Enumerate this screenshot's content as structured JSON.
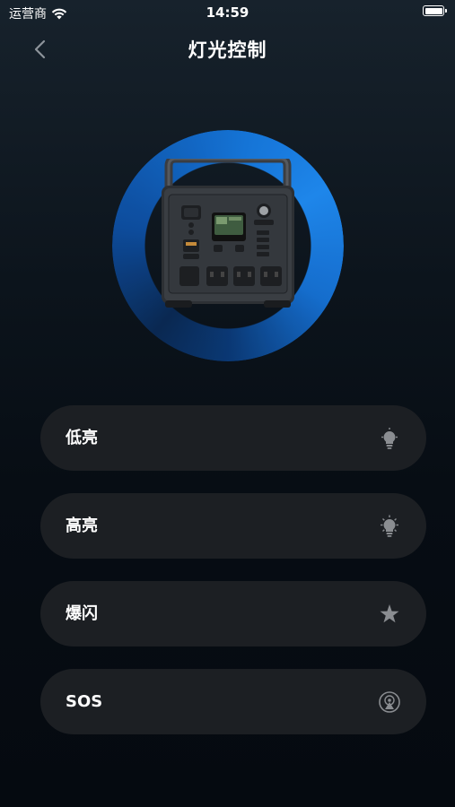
{
  "status_bar": {
    "carrier": "运营商",
    "time": "14:59"
  },
  "nav": {
    "title": "灯光控制",
    "back_icon": "chevron-left-icon"
  },
  "hero": {
    "image": "portable-power-station",
    "ring_color": "#1a86f0"
  },
  "modes": [
    {
      "label": "低亮",
      "icon": "bulb-low-icon"
    },
    {
      "label": "高亮",
      "icon": "bulb-high-icon"
    },
    {
      "label": "爆闪",
      "icon": "strobe-star-icon"
    },
    {
      "label": "SOS",
      "icon": "sos-beacon-icon"
    }
  ],
  "colors": {
    "background": "#0a1118",
    "card": "#1c1f23",
    "text": "#ffffff",
    "icon": "#8a8d91"
  }
}
